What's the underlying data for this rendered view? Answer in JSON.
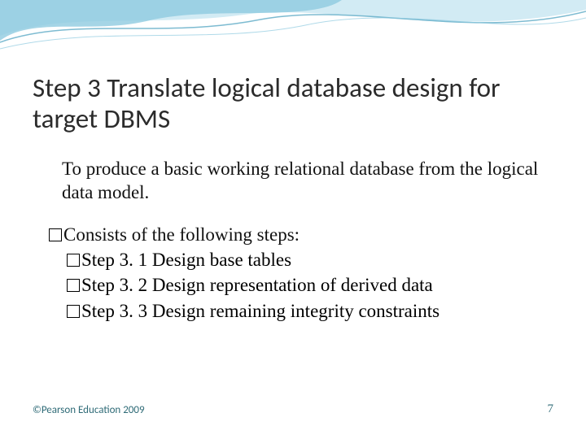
{
  "title": "Step 3 Translate logical database design for target DBMS",
  "intro": "To produce a basic working relational database from the logical data model.",
  "list_lead": "Consists of the following steps:",
  "steps": [
    "Step 3. 1  Design base tables",
    "Step 3. 2  Design representation of derived data",
    "Step 3. 3  Design remaining integrity constraints"
  ],
  "footer": {
    "copyright": "©Pearson Education 2009",
    "page_number": "7"
  },
  "theme": {
    "accent": "#2f6b77",
    "swoosh_light": "#bfe3ef",
    "swoosh_mid": "#8fcbe0",
    "swoosh_line": "#6fb4cc"
  }
}
